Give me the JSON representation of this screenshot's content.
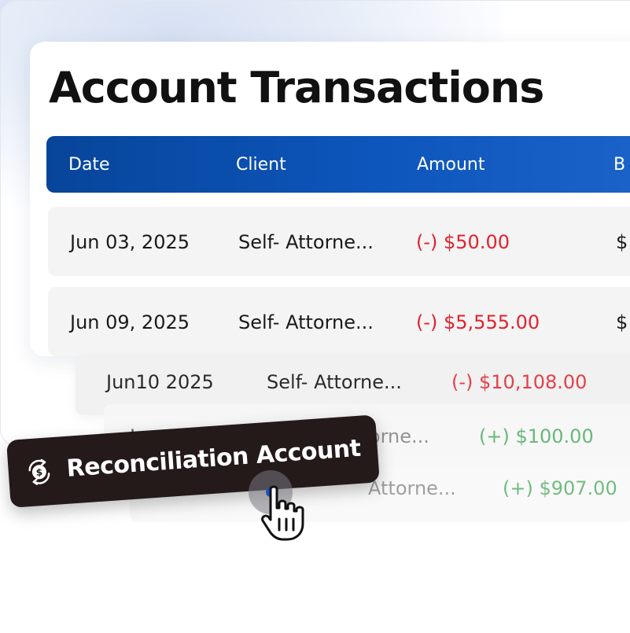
{
  "title": "Account Transactions",
  "columns": [
    "Date",
    "Client",
    "Amount",
    "B"
  ],
  "rows": [
    {
      "date": "Jun 03, 2025",
      "client": "Self- Attorne...",
      "amount": "(-) $50.00",
      "type": "debit",
      "extra": "$"
    },
    {
      "date": "Jun 09, 2025",
      "client": "Self- Attorne...",
      "amount": "(-) $5,555.00",
      "type": "debit",
      "extra": "$"
    },
    {
      "date": "Jun10 2025",
      "client": "Self- Attorne...",
      "amount": "(-) $10,108.00",
      "type": "debit",
      "extra": ""
    },
    {
      "date": "Jun 13, 2025",
      "client": "Self- Attorne...",
      "amount": "(+) $100.00",
      "type": "credit",
      "extra": ""
    },
    {
      "date": "",
      "client": "Attorne...",
      "amount": "(+) $907.00",
      "type": "credit",
      "extra": ""
    }
  ],
  "action_button": {
    "label": "Reconciliation Account",
    "icon": "currency-exchange-icon"
  },
  "cursor": {
    "icon": "hand-pointer-icon"
  },
  "colors": {
    "header_start": "#07459a",
    "header_end": "#1c63c9",
    "debit": "#e2222c",
    "credit": "#46a85a",
    "pill_bg": "#241a1a"
  }
}
